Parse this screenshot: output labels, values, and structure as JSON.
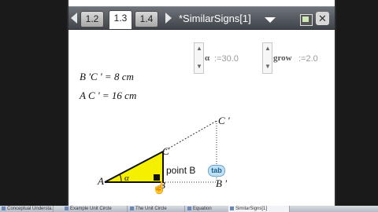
{
  "header": {
    "tabs": [
      "1.2",
      "1.3",
      "1.4"
    ],
    "active_tab": "1.3",
    "doc_title": "*SimilarSigns[1]"
  },
  "canvas": {
    "measure_bc": "B 'C ' = 8 cm",
    "measure_ac": "A C ' = 16 cm",
    "slider_alpha": {
      "name": "α",
      "value": ":=30.0"
    },
    "slider_grow": {
      "name": "grow",
      "value": ":=2.0"
    },
    "label_a": "A",
    "label_b": "B",
    "label_c": "C",
    "label_c_prime": "C '",
    "label_b_prime": "B '",
    "label_alpha": "α",
    "point_label": "point B",
    "tab_badge": "tab"
  },
  "taskbar": {
    "items": [
      "Conceptual Understa...",
      "Example Unit Circle",
      "The Unit Circle",
      "Equation",
      "SimilarSigns[1]"
    ]
  },
  "colors": {
    "triangle_fill": "#f5ef00",
    "topbar": "#4a4f56"
  }
}
